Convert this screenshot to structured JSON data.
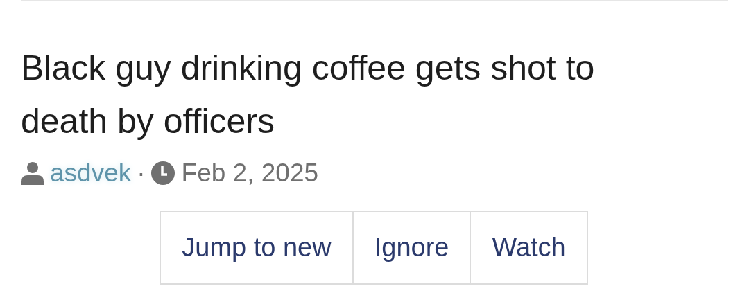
{
  "thread": {
    "title": "Black guy drinking coffee gets shot to death by officers",
    "author": "asdvek",
    "separator": "·",
    "date": "Feb 2, 2025"
  },
  "buttons": [
    "Jump to new",
    "Ignore",
    "Watch"
  ]
}
